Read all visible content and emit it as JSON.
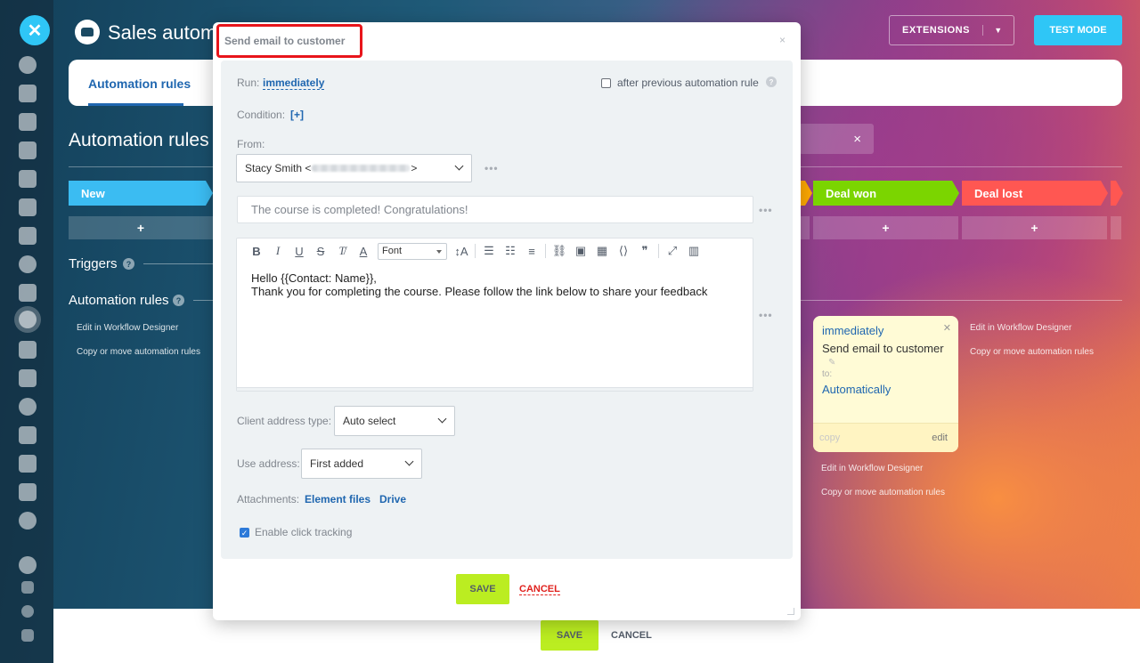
{
  "app": {
    "title": "Sales automa",
    "extensions_label": "EXTENSIONS",
    "test_mode_label": "TEST MODE",
    "active_tab": "Automation rules",
    "page_heading": "Automation rules",
    "search_clear": "×",
    "stages": [
      {
        "label": "New",
        "color": "#3bbcf2"
      },
      {
        "label": "Deal won",
        "color": "#7bd500"
      },
      {
        "label": "Deal lost",
        "color": "#ff5752"
      }
    ],
    "stage_add": "+",
    "triggers_label": "Triggers",
    "automation_rules_label": "Automation rules",
    "help": "?",
    "edit_in_designer": "Edit in Workflow Designer",
    "copy_or_move": "Copy or move automation rules",
    "rule_card": {
      "when": "immediately",
      "title": "Send email to customer",
      "to_label": "to:",
      "to_value": "Automatically",
      "copy": "copy",
      "edit": "edit"
    },
    "bottom": {
      "save": "SAVE",
      "cancel": "CANCEL"
    }
  },
  "modal": {
    "title": "Send email to customer",
    "close": "×",
    "run_label": "Run:",
    "run_value": "immediately",
    "after_previous_label": "after previous automation rule",
    "after_previous_checked": false,
    "condition_label": "Condition:",
    "condition_add": "[+]",
    "from_label": "From:",
    "from_name": "Stacy Smith <",
    "from_suffix": ">",
    "more": "•••",
    "subject": "The course is completed! Congratulations!",
    "font_select": "Font",
    "body_line1": "Hello {{Contact: Name}},",
    "body_line2": "Thank you for completing the course. Please follow the link below to share your feedback",
    "client_address_type_label": "Client address type:",
    "client_address_type_value": "Auto select",
    "use_address_label": "Use address:",
    "use_address_value": "First added",
    "attachments_label": "Attachments:",
    "attachment_element_files": "Element files",
    "attachment_drive": "Drive",
    "click_tracking_label": "Enable click tracking",
    "click_tracking_checked": true,
    "save": "SAVE",
    "cancel": "CANCEL"
  },
  "colors": {
    "accent_blue": "#2067b0",
    "save_green": "#bbed21",
    "cancel_red": "#e0211d",
    "highlight_red": "#e8151b",
    "test_mode_blue": "#2fc6f6"
  }
}
